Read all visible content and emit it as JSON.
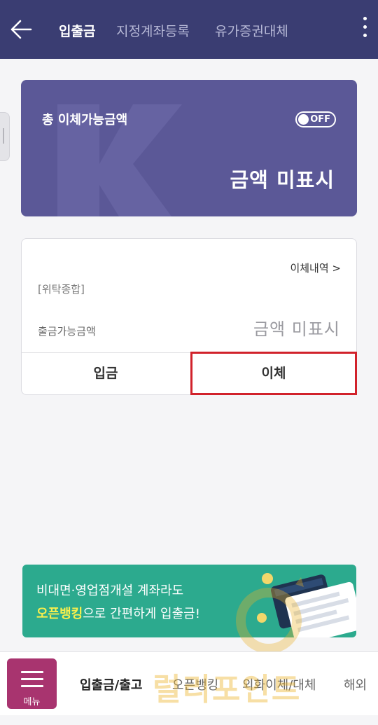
{
  "header": {
    "tabs": [
      {
        "label": "입출금"
      },
      {
        "label": "지정계좌등록"
      },
      {
        "label": "유가증권대체"
      }
    ]
  },
  "balance_card": {
    "title": "총 이체가능금액",
    "toggle_label": "OFF",
    "amount_text": "금액 미표시"
  },
  "account_card": {
    "history_link": "이체내역 >",
    "account_type": "[위탁종합]",
    "available_label": "출금가능금액",
    "available_amount": "금액 미표시",
    "deposit_label": "입금",
    "transfer_label": "이체"
  },
  "promo": {
    "line1": "비대면·영업점개설 계좌라도",
    "line2_highlight": "오픈뱅킹",
    "line2_rest": "으로 간편하게 입출금!"
  },
  "bottom_nav": {
    "menu_label": "메뉴",
    "items": [
      {
        "label": "입출금/출고"
      },
      {
        "label": "오픈뱅킹"
      },
      {
        "label": "외화이체/대체"
      },
      {
        "label": "해외"
      }
    ]
  },
  "watermark": {
    "text": "럴리포인트"
  },
  "colors": {
    "header_bg": "#3a3d72",
    "card_bg": "#5b5897",
    "highlight_border": "#d1222b",
    "promo_bg": "#2caa8e",
    "menu_bg": "#a8346f"
  }
}
